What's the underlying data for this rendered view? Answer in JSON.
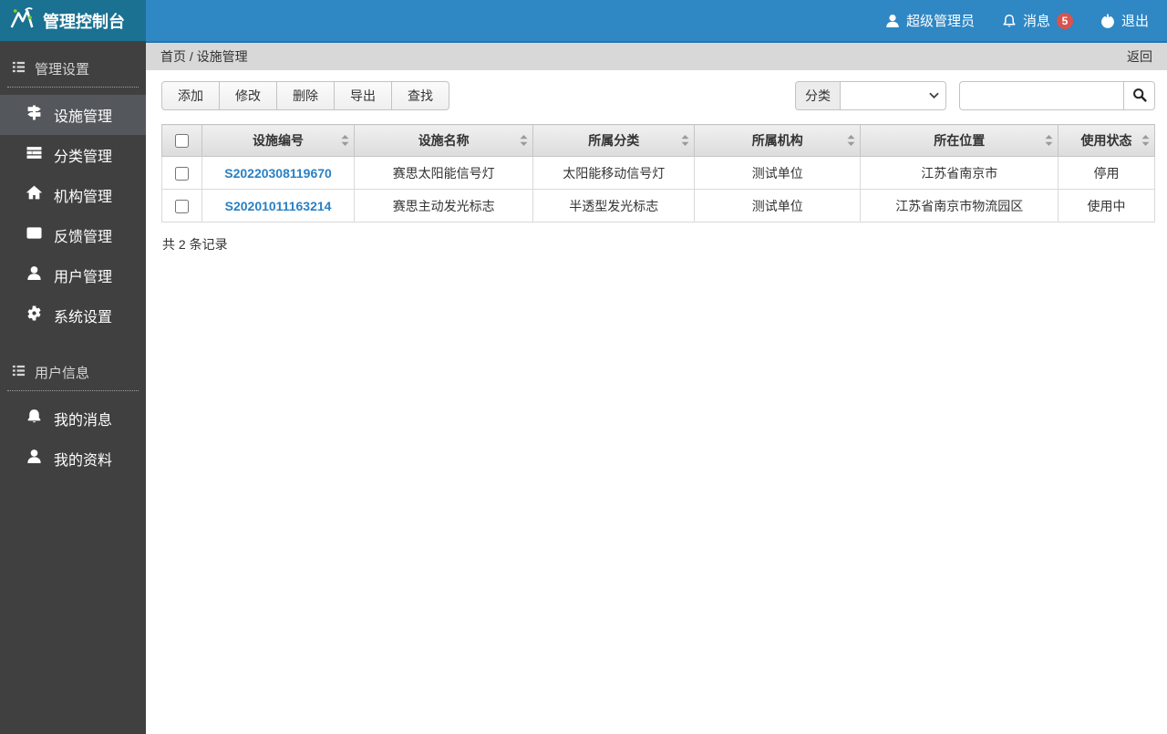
{
  "header": {
    "app_title": "管理控制台",
    "user_name": "超级管理员",
    "messages_label": "消息",
    "messages_count": "5",
    "logout_label": "退出"
  },
  "sidebar": {
    "sections": [
      {
        "title": "管理设置",
        "icon": "list",
        "items": [
          {
            "label": "设施管理",
            "icon": "map-signs",
            "active": true
          },
          {
            "label": "分类管理",
            "icon": "indent-list",
            "active": false
          },
          {
            "label": "机构管理",
            "icon": "home",
            "active": false
          },
          {
            "label": "反馈管理",
            "icon": "envelope",
            "active": false
          },
          {
            "label": "用户管理",
            "icon": "user",
            "active": false
          },
          {
            "label": "系统设置",
            "icon": "gear",
            "active": false
          }
        ]
      },
      {
        "title": "用户信息",
        "icon": "list",
        "items": [
          {
            "label": "我的消息",
            "icon": "bell",
            "active": false
          },
          {
            "label": "我的资料",
            "icon": "user",
            "active": false
          }
        ]
      }
    ]
  },
  "breadcrumb": {
    "path": "首页 / 设施管理",
    "back_label": "返回"
  },
  "toolbar": {
    "buttons": [
      {
        "label": "添加",
        "name": "add"
      },
      {
        "label": "修改",
        "name": "edit"
      },
      {
        "label": "删除",
        "name": "delete"
      },
      {
        "label": "导出",
        "name": "export"
      },
      {
        "label": "查找",
        "name": "find"
      }
    ],
    "filter_label": "分类",
    "filter_selected": "",
    "search_value": "",
    "search_placeholder": ""
  },
  "table": {
    "columns": [
      "设施编号",
      "设施名称",
      "所属分类",
      "所属机构",
      "所在位置",
      "使用状态"
    ],
    "rows": [
      [
        "S20220308119670",
        "赛思太阳能信号灯",
        "太阳能移动信号灯",
        "测试单位",
        "江苏省南京市",
        "停用"
      ],
      [
        "S20201011163214",
        "赛思主动发光标志",
        "半透型发光标志",
        "测试单位",
        "江苏省南京市物流园区",
        "使用中"
      ]
    ],
    "summary": "共 2 条记录"
  },
  "colors": {
    "navbar": "#2f87c4",
    "logo_bg": "#1a7192",
    "sidebar_bg": "#404040",
    "sidebar_active_bg": "#54575c",
    "badge_red": "#d9534f",
    "link_blue": "#2980c4",
    "breadcrumb_bg": "#d8d8d8"
  }
}
